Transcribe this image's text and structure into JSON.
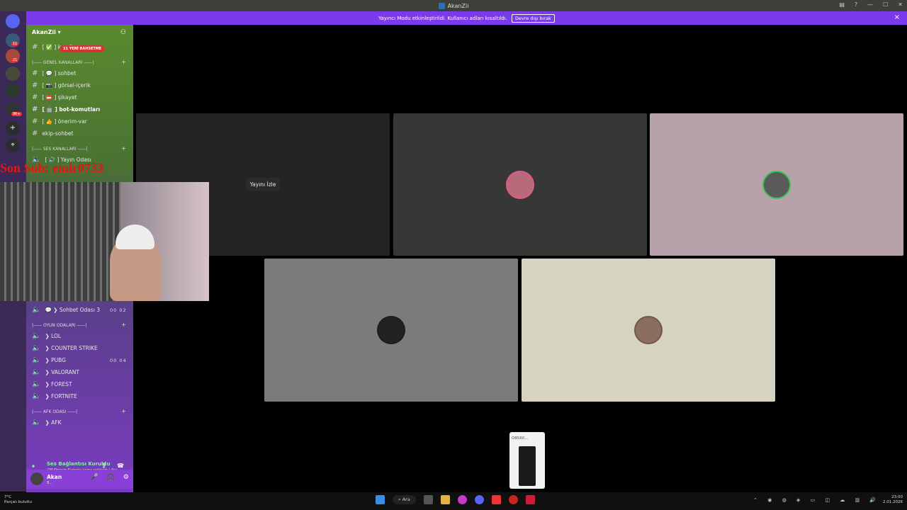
{
  "window": {
    "title": "AkanZii"
  },
  "banner": {
    "message": "Yayıncı Modu etkinleştirildi. Kullanıcı adları kısaltıldı.",
    "button": "Devre dışı bırak",
    "close": "×"
  },
  "server": {
    "name": "AkanZii",
    "new_mentions": "11 YENİ BAHSETME"
  },
  "server_badges": [
    "11",
    "21",
    "9K+"
  ],
  "channels": {
    "rules": "[ ✅ ] kurallar",
    "cat_general": "|—— GENEL KANALLARI ——|",
    "text": [
      {
        "label": "[ 💬 ] sohbet"
      },
      {
        "label": "[ 📷 ] görsel-içerik"
      },
      {
        "label": "[ 📛 ] şikayet"
      },
      {
        "label": "[ 🤖 ] bot-komutları"
      },
      {
        "label": "[ 👍 ] önerim-var"
      },
      {
        "label": "ekip-sohbet"
      }
    ],
    "cat_voice": "|—— SES KANALLARI ——|",
    "voice_top": "[ 🔊 ] Yayın Odası",
    "sohbet3": {
      "label": "💬 ❯ Sohbet Odası 3",
      "count": "00 02"
    },
    "cat_games": "|—— OYUN ODALARI ——|",
    "games": [
      {
        "label": "❯ LOL"
      },
      {
        "label": "❯ COUNTER STRIKE"
      },
      {
        "label": "❯ PUBG",
        "count": "00 04"
      },
      {
        "label": "❯ VALORANT"
      },
      {
        "label": "❯ FOREST"
      },
      {
        "label": "❯ FORTNITE"
      }
    ],
    "cat_afk": "|—— AFK ODASI ——|",
    "afk": "❯ AFK"
  },
  "overlay_text": "Son Sub: emir0733",
  "voice": {
    "status": "Ses Bağlantısı Kuruldu",
    "sub": "Off Stream Kamera açma gelirsen / Aka..."
  },
  "user": {
    "name": "Akan",
    "status": "B..."
  },
  "stage": {
    "watch_label": "Yayını İzle"
  },
  "popup": {
    "label": "OBS60..."
  },
  "taskbar": {
    "temp": "7°C",
    "weather": "Parçalı bulutlu",
    "search": "Ara",
    "time": "23:00",
    "date": "2.01.2026"
  },
  "colors": {
    "banner": "#7c3aed",
    "accent_red": "#d63333",
    "voice_green": "#7bf7a0",
    "user_bar": "#8a3fd6"
  }
}
